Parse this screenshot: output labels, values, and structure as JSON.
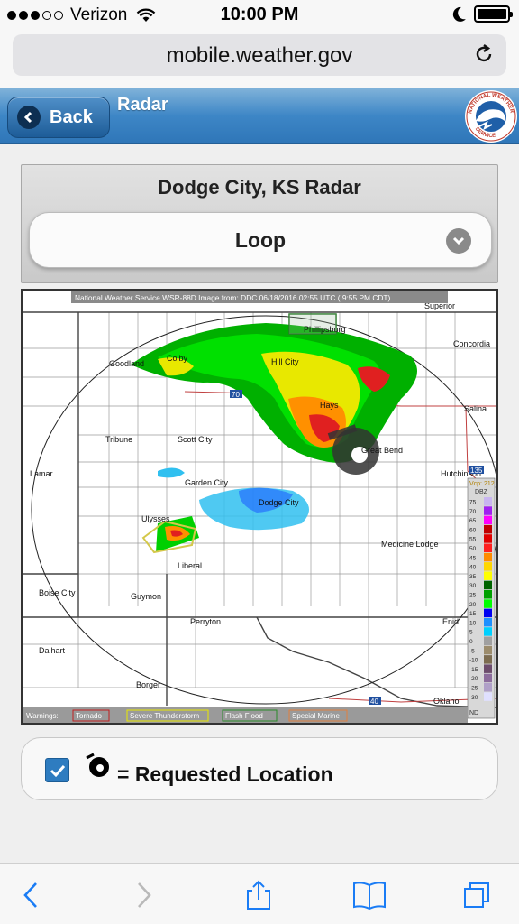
{
  "status_bar": {
    "carrier": "Verizon",
    "time": "10:00 PM"
  },
  "browser": {
    "url": "mobile.weather.gov"
  },
  "header": {
    "back_label": "Back",
    "title": "Radar"
  },
  "radar": {
    "title": "Dodge City, KS Radar",
    "mode": "Loop",
    "image_caption": "National Weather Service WSR-88D Image from: DDC 06/18/2016 02:55 UTC ( 9:55 PM CDT)",
    "cities": {
      "phillipsburg": "Phillipsburg",
      "superior": "Superior",
      "goodland": "Goodland",
      "colby": "Colby",
      "hill_city": "Hill City",
      "concordia": "Concordia",
      "hays": "Hays",
      "salina": "Salina",
      "tribune": "Tribune",
      "scott_city": "Scott City",
      "great_bend": "Great Bend",
      "lamar": "Lamar",
      "hutchinson": "Hutchinson",
      "garden_city": "Garden City",
      "dodge_city": "Dodge City",
      "ulysses": "Ulysses",
      "medicine_lodge": "Medicine Lodge",
      "liberal": "Liberal",
      "boise_city": "Boise City",
      "guymon": "Guymon",
      "perryton": "Perryton",
      "enid": "Enid",
      "dalhart": "Dalhart",
      "borger": "Borger",
      "oklahoma": "Oklaho"
    },
    "highways": {
      "i70": "70",
      "i135": "135",
      "i40": "40"
    },
    "legend": {
      "vcp": "Vcp: 212",
      "unit": "DBZ",
      "nd": "ND",
      "levels": [
        "75",
        "70",
        "65",
        "60",
        "55",
        "50",
        "45",
        "40",
        "35",
        "30",
        "25",
        "20",
        "15",
        "10",
        "5",
        "0",
        "-5",
        "-10",
        "-15",
        "-20",
        "-25",
        "-30"
      ],
      "colors": [
        "#c8b4f0",
        "#a020f0",
        "#ff00ff",
        "#c00000",
        "#e00000",
        "#ff2020",
        "#ff8c00",
        "#ffd700",
        "#ffff00",
        "#006400",
        "#00a000",
        "#00ff00",
        "#0000f0",
        "#1e90ff",
        "#00d0ff",
        "#a0a0a0",
        "#9c8c6c",
        "#7c6c50",
        "#6c4c6c",
        "#8c6c9c",
        "#b0a0c8",
        "#e0e0ff"
      ]
    },
    "warnings": {
      "label": "Warnings:",
      "tornado": "Tornado",
      "severe": "Severe Thunderstorm",
      "flood": "Flash Flood",
      "marine": "Special Marine"
    }
  },
  "requested_location": {
    "label": "= Requested Location",
    "checked": true
  }
}
